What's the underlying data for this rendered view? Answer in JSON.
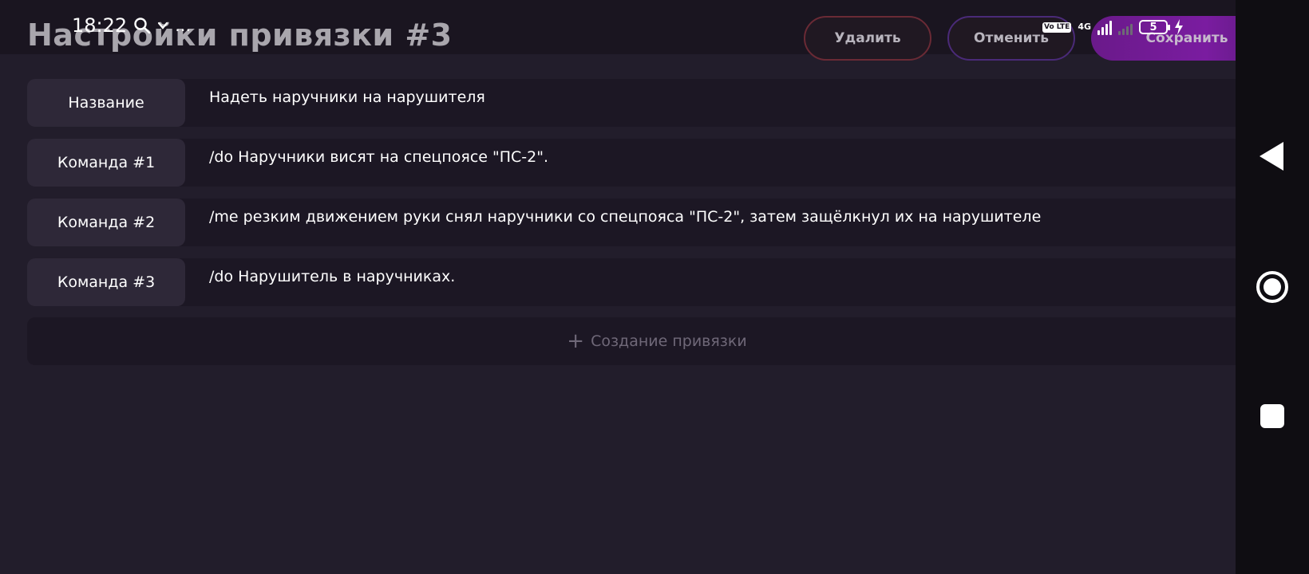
{
  "status_bar": {
    "time": "18:22",
    "extra": "…",
    "network": "4G",
    "volte": "Vo LTE",
    "battery": "5"
  },
  "header": {
    "title": "Настройки привязки #3",
    "buttons": {
      "delete": "Удалить",
      "cancel": "Отменить",
      "save": "Сохранить"
    }
  },
  "rows": [
    {
      "label": "Название",
      "value": "Надеть наручники на нарушителя"
    },
    {
      "label": "Команда #1",
      "value": "/do Наручники висят на спецпоясе \"ПС-2\"."
    },
    {
      "label": "Команда #2",
      "value": "/me резким движением руки снял наручники со спецпояса \"ПС-2\", затем защёлкнул их на нарушителе"
    },
    {
      "label": "Команда #3",
      "value": "/do Нарушитель в наручниках."
    }
  ],
  "add_binding": {
    "icon": "plus-icon",
    "label": "Создание привязки"
  },
  "nav_bar": {
    "icons": [
      "back-icon",
      "home-icon",
      "recents-icon"
    ]
  },
  "colors": {
    "background": "#221d2b",
    "row": "#1c1724",
    "label_bg": "#2e2838",
    "save_accent": "#7a1ca0",
    "delete_border": "#6a2a35",
    "cancel_border": "#4a2a78"
  }
}
